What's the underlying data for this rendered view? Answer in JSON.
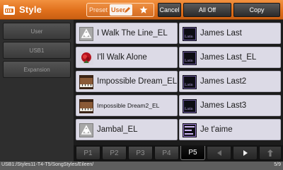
{
  "header": {
    "title": "Style",
    "icon": "style-folder-icon",
    "segments": {
      "preset": "Preset",
      "user": "User",
      "favorite_icon": "star-icon"
    },
    "buttons": {
      "cancel": "Cancel",
      "all_off": "All Off",
      "copy": "Copy"
    }
  },
  "sidebar": {
    "items": [
      {
        "label": "User"
      },
      {
        "label": "USB1"
      },
      {
        "label": "Expansion"
      }
    ]
  },
  "files": [
    {
      "name": "I Walk The Line_EL",
      "icon": "electone-logo-icon"
    },
    {
      "name": "James Last",
      "icon": "latin-logo-icon"
    },
    {
      "name": "I'll Walk Alone",
      "icon": "red-rose-icon"
    },
    {
      "name": "James Last_EL",
      "icon": "latin-logo-icon"
    },
    {
      "name": "Impossible Dream_EL",
      "icon": "piano-icon"
    },
    {
      "name": "James Last2",
      "icon": "latin-logo-icon"
    },
    {
      "name": "Impossible Dream2_EL",
      "icon": "piano-icon"
    },
    {
      "name": "James Last3",
      "icon": "latin-logo-icon"
    },
    {
      "name": "Jambal_EL",
      "icon": "electone-logo-icon"
    },
    {
      "name": "Je t'aime",
      "icon": "easy-listening-icon"
    }
  ],
  "pagination": {
    "tabs": [
      "P1",
      "P2",
      "P3",
      "P4",
      "P5"
    ],
    "active": "P5",
    "prev_icon": "triangle-left-icon",
    "next_icon": "triangle-right-icon",
    "up_icon": "folder-up-icon"
  },
  "status": {
    "path": "USB1:/Styles11-T4-T5/SongStyles/Eileen/",
    "page": "5/9"
  },
  "colors": {
    "header_orange": "#e0701c",
    "tile_bg": "#dcdae6",
    "sidebar_bg": "#2e2e2e"
  }
}
